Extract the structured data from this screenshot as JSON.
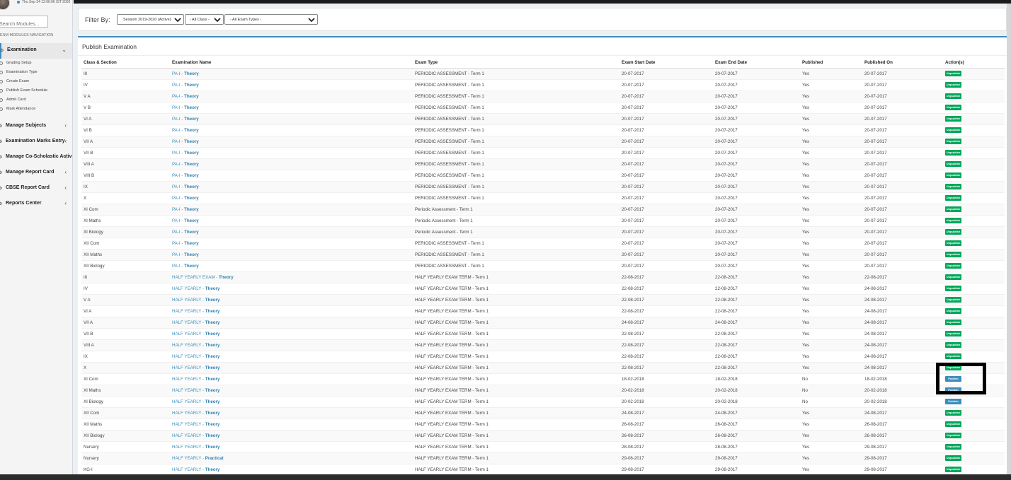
{
  "sidebar": {
    "datetime": "Thu Sep 24 12:06:06 IST 2020",
    "search_placeholder": "Search Modules...",
    "nav_header": "ESM MODULES NAVIGATION",
    "menu": [
      {
        "label": "Examination",
        "icon": "cogs-icon",
        "active": true,
        "sub": [
          "Grading Setup",
          "Examination Type",
          "Create Exam",
          "Publish Exam Schedule",
          "Admit Card",
          "Mark Attendance"
        ]
      },
      {
        "label": "Manage Subjects",
        "icon": "cogs-icon"
      },
      {
        "label": "Examination Marks Entry",
        "icon": "cogs-icon"
      },
      {
        "label": "Manage Co-Scholastic Activities",
        "icon": "cogs-icon"
      },
      {
        "label": "Manage Report Card",
        "icon": "cogs-icon"
      },
      {
        "label": "CBSE Report Card",
        "icon": "cogs-icon"
      },
      {
        "label": "Reports Center",
        "icon": "cogs-icon"
      }
    ]
  },
  "filter": {
    "label": "Filter By:",
    "session": "Session 2019-2020 (Active)",
    "class": "- All Class -",
    "exam_type": "- All Exam Types -"
  },
  "panel": {
    "title": "Publish Examination",
    "columns": [
      "Class & Section",
      "Examination Name",
      "Exam Type",
      "Exam Start Date",
      "Exam End Date",
      "Published",
      "Published On",
      "Action(s)"
    ],
    "rows": [
      {
        "cls": "III",
        "name_pre": "PA-I - ",
        "name_bold": "Theory",
        "type": "PERIODIC ASSESSMENT - Term 1",
        "start": "20-07-2017",
        "end": "20-07-2017",
        "published": "Yes",
        "on": "20-07-2017",
        "action": "Unpublish"
      },
      {
        "cls": "IV",
        "name_pre": "PA-I - ",
        "name_bold": "Theory",
        "type": "PERIODIC ASSESSMENT - Term 1",
        "start": "20-07-2017",
        "end": "20-07-2017",
        "published": "Yes",
        "on": "20-07-2017",
        "action": "Unpublish"
      },
      {
        "cls": "V A",
        "name_pre": "PA-I - ",
        "name_bold": "Theory",
        "type": "PERIODIC ASSESSMENT - Term 1",
        "start": "20-07-2017",
        "end": "20-07-2017",
        "published": "Yes",
        "on": "20-07-2017",
        "action": "Unpublish"
      },
      {
        "cls": "V B",
        "name_pre": "PA-I - ",
        "name_bold": "Theory",
        "type": "PERIODIC ASSESSMENT - Term 1",
        "start": "20-07-2017",
        "end": "20-07-2017",
        "published": "Yes",
        "on": "20-07-2017",
        "action": "Unpublish"
      },
      {
        "cls": "VI A",
        "name_pre": "PA-I - ",
        "name_bold": "Theory",
        "type": "PERIODIC ASSESSMENT - Term 1",
        "start": "20-07-2017",
        "end": "20-07-2017",
        "published": "Yes",
        "on": "20-07-2017",
        "action": "Unpublish"
      },
      {
        "cls": "VI B",
        "name_pre": "PA-I - ",
        "name_bold": "Theory",
        "type": "PERIODIC ASSESSMENT - Term 1",
        "start": "20-07-2017",
        "end": "20-07-2017",
        "published": "Yes",
        "on": "20-07-2017",
        "action": "Unpublish"
      },
      {
        "cls": "VII A",
        "name_pre": "PA-I - ",
        "name_bold": "Theory",
        "type": "PERIODIC ASSESSMENT - Term 1",
        "start": "20-07-2017",
        "end": "20-07-2017",
        "published": "Yes",
        "on": "20-07-2017",
        "action": "Unpublish"
      },
      {
        "cls": "VII B",
        "name_pre": "PA-I - ",
        "name_bold": "Theory",
        "type": "PERIODIC ASSESSMENT - Term 1",
        "start": "20-07-2017",
        "end": "20-07-2017",
        "published": "Yes",
        "on": "20-07-2017",
        "action": "Unpublish"
      },
      {
        "cls": "VIII A",
        "name_pre": "PA-I - ",
        "name_bold": "Theory",
        "type": "PERIODIC ASSESSMENT - Term 1",
        "start": "20-07-2017",
        "end": "20-07-2017",
        "published": "Yes",
        "on": "20-07-2017",
        "action": "Unpublish"
      },
      {
        "cls": "VIII B",
        "name_pre": "PA-I - ",
        "name_bold": "Theory",
        "type": "PERIODIC ASSESSMENT - Term 1",
        "start": "20-07-2017",
        "end": "20-07-2017",
        "published": "Yes",
        "on": "20-07-2017",
        "action": "Unpublish"
      },
      {
        "cls": "IX",
        "name_pre": "PA-I - ",
        "name_bold": "Theory",
        "type": "PERIODIC ASSESSMENT - Term 1",
        "start": "20-07-2017",
        "end": "20-07-2017",
        "published": "Yes",
        "on": "20-07-2017",
        "action": "Unpublish"
      },
      {
        "cls": "X",
        "name_pre": "PA-I - ",
        "name_bold": "Theory",
        "type": "PERIODIC ASSESSMENT - Term 1",
        "start": "20-07-2017",
        "end": "20-07-2017",
        "published": "Yes",
        "on": "20-07-2017",
        "action": "Unpublish"
      },
      {
        "cls": "XI Com",
        "name_pre": "PA-I - ",
        "name_bold": "Theory",
        "type": "Periodic Assessment - Term 1",
        "start": "20-07-2017",
        "end": "20-07-2017",
        "published": "Yes",
        "on": "20-07-2017",
        "action": "Unpublish"
      },
      {
        "cls": "XI Maths",
        "name_pre": "PA-I - ",
        "name_bold": "Theory",
        "type": "Periodic Assessment - Term 1",
        "start": "20-07-2017",
        "end": "20-07-2017",
        "published": "Yes",
        "on": "20-07-2017",
        "action": "Unpublish"
      },
      {
        "cls": "XI Biology",
        "name_pre": "PA-I - ",
        "name_bold": "Theory",
        "type": "Periodic Assessment - Term 1",
        "start": "20-07-2017",
        "end": "20-07-2017",
        "published": "Yes",
        "on": "20-07-2017",
        "action": "Unpublish"
      },
      {
        "cls": "XII Com",
        "name_pre": "PA-I - ",
        "name_bold": "Theory",
        "type": "PERIODIC ASSESSMENT - Term 1",
        "start": "20-07-2017",
        "end": "20-07-2017",
        "published": "Yes",
        "on": "20-07-2017",
        "action": "Unpublish"
      },
      {
        "cls": "XII Maths",
        "name_pre": "PA-I - ",
        "name_bold": "Theory",
        "type": "PERIODIC ASSESSMENT - Term 1",
        "start": "20-07-2017",
        "end": "20-07-2017",
        "published": "Yes",
        "on": "20-07-2017",
        "action": "Unpublish"
      },
      {
        "cls": "XII Biology",
        "name_pre": "PA-I - ",
        "name_bold": "Theory",
        "type": "PERIODIC ASSESSMENT - Term 1",
        "start": "20-07-2017",
        "end": "20-07-2017",
        "published": "Yes",
        "on": "20-07-2017",
        "action": "Unpublish"
      },
      {
        "cls": "III",
        "name_pre": "HALF YEARLY EXAM - ",
        "name_bold": "Theory",
        "type": "HALF YEARLY EXAM TERM - Term 1",
        "start": "22-08-2017",
        "end": "22-08-2017",
        "published": "Yes",
        "on": "22-08-2017",
        "action": "Unpublish"
      },
      {
        "cls": "IV",
        "name_pre": "HALF YEARLY - ",
        "name_bold": "Theory",
        "type": "HALF YEARLY EXAM TERM - Term 1",
        "start": "22-08-2017",
        "end": "22-08-2017",
        "published": "Yes",
        "on": "24-08-2017",
        "action": "Unpublish"
      },
      {
        "cls": "V A",
        "name_pre": "HALF YEARLY - ",
        "name_bold": "Theory",
        "type": "HALF YEARLY EXAM TERM - Term 1",
        "start": "22-08-2017",
        "end": "22-08-2017",
        "published": "Yes",
        "on": "24-08-2017",
        "action": "Unpublish"
      },
      {
        "cls": "VI A",
        "name_pre": "HALF YEARLY - ",
        "name_bold": "Theory",
        "type": "HALF YEARLY EXAM TERM - Term 1",
        "start": "22-08-2017",
        "end": "22-08-2017",
        "published": "Yes",
        "on": "24-08-2017",
        "action": "Unpublish"
      },
      {
        "cls": "VII A",
        "name_pre": "HALF YEARLY - ",
        "name_bold": "Theory",
        "type": "HALF YEARLY EXAM TERM - Term 1",
        "start": "24-08-2017",
        "end": "24-08-2017",
        "published": "Yes",
        "on": "24-08-2017",
        "action": "Unpublish"
      },
      {
        "cls": "VII B",
        "name_pre": "HALF YEARLY - ",
        "name_bold": "Theory",
        "type": "HALF YEARLY EXAM TERM - Term 1",
        "start": "22-08-2017",
        "end": "22-08-2017",
        "published": "Yes",
        "on": "24-08-2017",
        "action": "Unpublish"
      },
      {
        "cls": "VIII A",
        "name_pre": "HALF YEARLY - ",
        "name_bold": "Theory",
        "type": "HALF YEARLY EXAM TERM - Term 1",
        "start": "22-08-2017",
        "end": "22-08-2017",
        "published": "Yes",
        "on": "24-08-2017",
        "action": "Unpublish"
      },
      {
        "cls": "IX",
        "name_pre": "HALF YEARLY - ",
        "name_bold": "Theory",
        "type": "HALF YEARLY EXAM TERM - Term 1",
        "start": "22-08-2017",
        "end": "22-08-2017",
        "published": "Yes",
        "on": "24-08-2017",
        "action": "Unpublish"
      },
      {
        "cls": "X",
        "name_pre": "HALF YEARLY - ",
        "name_bold": "Theory",
        "type": "HALF YEARLY EXAM TERM - Term 1",
        "start": "22-08-2017",
        "end": "22-08-2017",
        "published": "Yes",
        "on": "24-08-2017",
        "action": "Unpublish"
      },
      {
        "cls": "XI Com",
        "name_pre": "HALF YEARLY - ",
        "name_bold": "Theory",
        "type": "HALF YEARLY EXAM TERM - Term 1",
        "start": "18-02-2018",
        "end": "18-02-2018",
        "published": "No",
        "on": "18-02-2018",
        "action": "Publish"
      },
      {
        "cls": "XI Maths",
        "name_pre": "HALF YEARLY - ",
        "name_bold": "Theory",
        "type": "HALF YEARLY EXAM TERM - Term 1",
        "start": "20-02-2018",
        "end": "20-02-2018",
        "published": "No",
        "on": "20-02-2018",
        "action": "Publish"
      },
      {
        "cls": "XI Biology",
        "name_pre": "HALF YEARLY - ",
        "name_bold": "Theory",
        "type": "HALF YEARLY EXAM TERM - Term 1",
        "start": "20-02-2018",
        "end": "20-02-2018",
        "published": "No",
        "on": "20-02-2018",
        "action": "Publish"
      },
      {
        "cls": "XII Com",
        "name_pre": "HALF YEARLY - ",
        "name_bold": "Theory",
        "type": "HALF YEARLY EXAM TERM - Term 1",
        "start": "24-08-2017",
        "end": "24-08-2017",
        "published": "Yes",
        "on": "24-08-2017",
        "action": "Unpublish"
      },
      {
        "cls": "XII Maths",
        "name_pre": "HALF YEARLY - ",
        "name_bold": "Theory",
        "type": "HALF YEARLY EXAM TERM - Term 1",
        "start": "26-08-2017",
        "end": "26-08-2017",
        "published": "Yes",
        "on": "26-08-2017",
        "action": "Unpublish"
      },
      {
        "cls": "XII Biology",
        "name_pre": "HALF YEARLY - ",
        "name_bold": "Theory",
        "type": "HALF YEARLY EXAM TERM - Term 1",
        "start": "26-08-2017",
        "end": "26-08-2017",
        "published": "Yes",
        "on": "26-08-2017",
        "action": "Unpublish"
      },
      {
        "cls": "Nursery",
        "name_pre": "HALF YEARLY - ",
        "name_bold": "Theory",
        "type": "HALF YEARLY EXAM TERM - Term 1",
        "start": "28-08-2017",
        "end": "28-08-2017",
        "published": "Yes",
        "on": "29-08-2017",
        "action": "Unpublish"
      },
      {
        "cls": "Nursery",
        "name_pre": "HALF YEARLY - ",
        "name_bold": "Practical",
        "type": "HALF YEARLY EXAM TERM - Term 1",
        "start": "29-08-2017",
        "end": "29-08-2017",
        "published": "Yes",
        "on": "29-08-2017",
        "action": "Unpublish"
      },
      {
        "cls": "KG-I",
        "name_pre": "HALF YEARLY - ",
        "name_bold": "Theory",
        "type": "HALF YEARLY EXAM TERM - Term 1",
        "start": "29-08-2017",
        "end": "29-08-2017",
        "published": "Yes",
        "on": "29-08-2017",
        "action": "Unpublish"
      }
    ]
  },
  "colors": {
    "primary": "#3c8dbc",
    "success": "#00a65a"
  }
}
